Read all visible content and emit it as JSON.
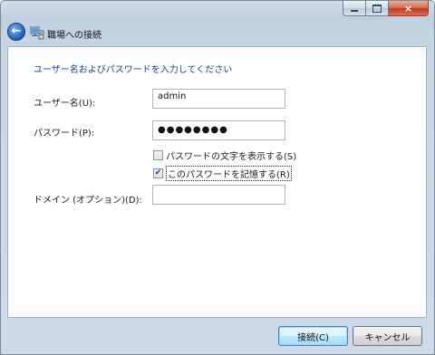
{
  "window": {
    "title": "職場への接続",
    "caption": {
      "minimize": "minimize",
      "maximize": "maximize",
      "close": "×"
    }
  },
  "nav": {
    "back_glyph": "←"
  },
  "form": {
    "instruction": "ユーザー名およびパスワードを入力してください",
    "username_label": "ユーザー名(U):",
    "username_value": "admin",
    "password_label": "パスワード(P):",
    "password_masked": "●●●●●●●●",
    "show_chars_label": "パスワードの文字を表示する(S)",
    "show_chars_checked": false,
    "remember_label": "このパスワードを記憶する(R)",
    "remember_checked": true,
    "domain_label": "ドメイン (オプション)(D):",
    "domain_value": ""
  },
  "buttons": {
    "connect": "接続(C)",
    "cancel": "キャンセル"
  },
  "colors": {
    "instruction": "#1a3e9b",
    "close_button": "#c0391a",
    "back_button": "#1d5fb4"
  },
  "icons": {
    "back": "back-arrow-icon",
    "network": "network-connection-icon",
    "check": "checkmark-icon"
  }
}
